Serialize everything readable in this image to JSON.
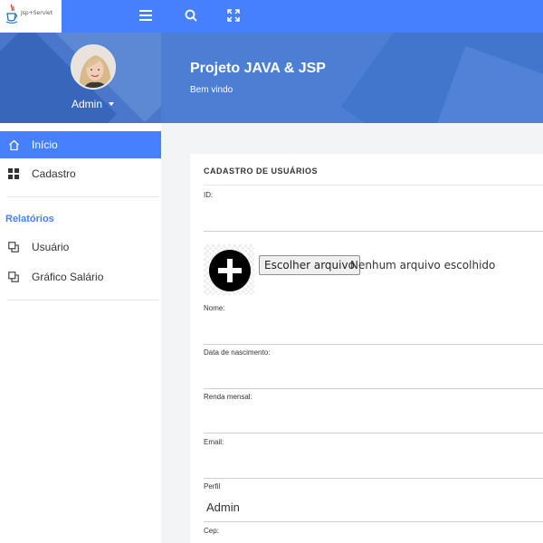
{
  "topbar": {
    "logo_text": "Jsp+Servlet",
    "icons": [
      "menu-icon",
      "search-icon",
      "fullscreen-icon"
    ]
  },
  "user": {
    "name": "Admin"
  },
  "banner": {
    "title": "Projeto JAVA & JSP",
    "subtitle": "Bem vindo"
  },
  "sidebar": {
    "items": [
      {
        "label": "Início",
        "icon": "home-icon",
        "active": true
      },
      {
        "label": "Cadastro",
        "icon": "grid-icon",
        "active": false
      }
    ],
    "section_title": "Relatórios",
    "report_items": [
      {
        "label": "Usuário",
        "icon": "copy-icon"
      },
      {
        "label": "Gráfico Salário",
        "icon": "copy-icon"
      }
    ]
  },
  "form": {
    "title": "CADASTRO DE USUÁRIOS",
    "id_label": "ID:",
    "file_button": "Escolher arquivo",
    "file_status": "Nenhum arquivo escolhido",
    "nome_label": "Nome:",
    "nascimento_label": "Data de nascimento:",
    "renda_label": "Renda mensal:",
    "email_label": "Email:",
    "perfil_label": "Perfil",
    "perfil_value": "Admin",
    "cep_label": "Cep:"
  },
  "colors": {
    "primary": "#4680ff",
    "banner": "#4c7fd4",
    "sidebar_header": "#4a77c9"
  }
}
